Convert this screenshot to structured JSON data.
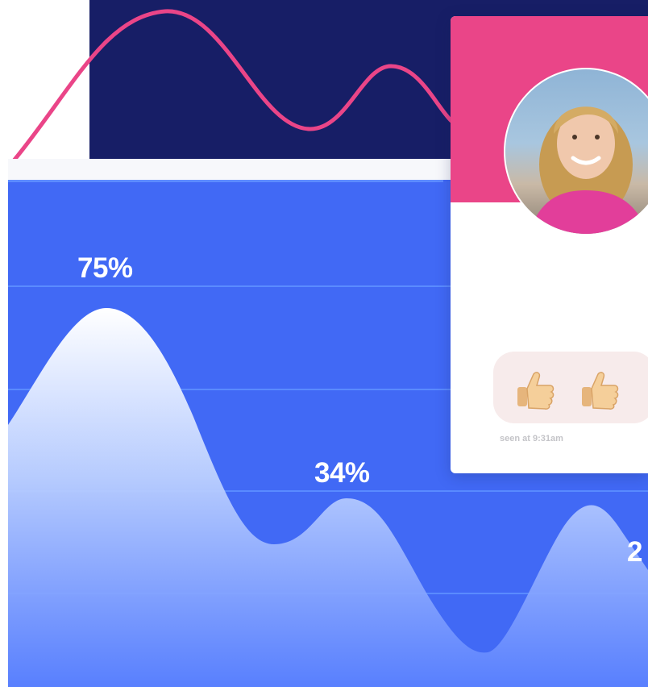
{
  "colors": {
    "navy": "#171e66",
    "pink": "#ea4588",
    "chart_blue": "#4169f5",
    "bubble": "#f7ebeb"
  },
  "chart": {
    "peak_labels": [
      "75%",
      "34%",
      "2"
    ]
  },
  "chart_data": {
    "type": "area",
    "title": "",
    "xlabel": "",
    "ylabel": "",
    "grid": true,
    "points": [
      {
        "x": 1,
        "y": 75,
        "label": "75%"
      },
      {
        "x": 2,
        "y": 34,
        "label": "34%"
      },
      {
        "x": 3,
        "y": 27
      }
    ],
    "legend": "none"
  },
  "profile": {
    "avatar_icon": "person-photo",
    "reactions": [
      "thumbs-up-icon",
      "thumbs-up-icon"
    ],
    "seen_text": "seen at 9:31am"
  }
}
